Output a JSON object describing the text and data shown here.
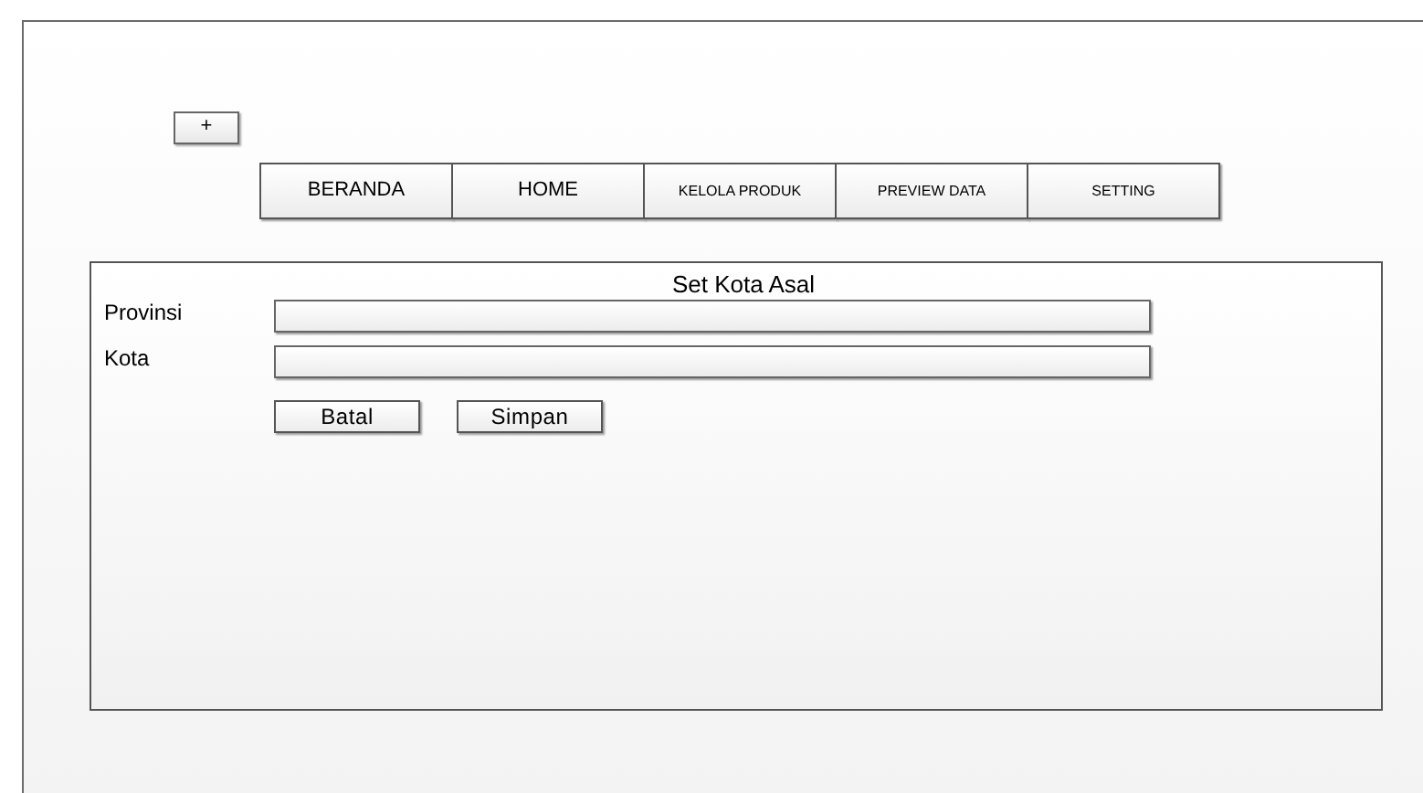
{
  "add_button": {
    "label": "+"
  },
  "nav": [
    {
      "label": "BERANDA",
      "kind": "large"
    },
    {
      "label": "HOME",
      "kind": "large"
    },
    {
      "label": "KELOLA PRODUK",
      "kind": "small"
    },
    {
      "label": "PREVIEW DATA",
      "kind": "small"
    },
    {
      "label": "SETTING",
      "kind": "small"
    }
  ],
  "panel": {
    "title": "Set Kota Asal",
    "fields": [
      {
        "label": "Provinsi"
      },
      {
        "label": "Kota"
      }
    ],
    "buttons": [
      "Batal",
      "Simpan"
    ]
  }
}
